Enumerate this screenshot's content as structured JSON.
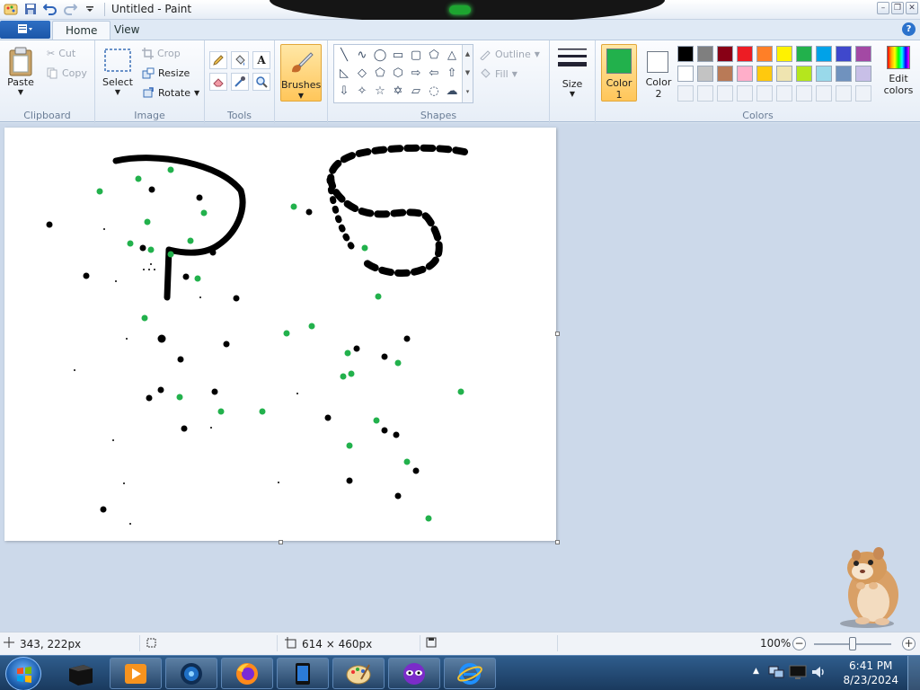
{
  "window": {
    "title": "Untitled - Paint"
  },
  "quick_access": {
    "icons": [
      "paint-app-icon",
      "save-icon",
      "undo-icon",
      "redo-icon",
      "customize-qat-icon"
    ]
  },
  "tabs": [
    {
      "label": "Home"
    },
    {
      "label": "View"
    }
  ],
  "ribbon": {
    "clipboard": {
      "label": "Clipboard",
      "paste": "Paste",
      "cut": "Cut",
      "copy": "Copy"
    },
    "image": {
      "label": "Image",
      "select": "Select",
      "crop": "Crop",
      "resize": "Resize",
      "rotate": "Rotate"
    },
    "tools": {
      "label": "Tools"
    },
    "brushes": {
      "label": "Brushes"
    },
    "shapes": {
      "label": "Shapes",
      "outline": "Outline",
      "fill": "Fill"
    },
    "size": {
      "label": "Size"
    },
    "colors": {
      "label": "Colors",
      "color1_label_line1": "Color",
      "color1_label_line2": "1",
      "color2_label_line1": "Color",
      "color2_label_line2": "2",
      "edit_line1": "Edit",
      "edit_line2": "colors",
      "color1": "#22b14c",
      "color2": "#ffffff",
      "palette_row1": [
        "#000000",
        "#7f7f7f",
        "#880015",
        "#ed1c24",
        "#ff7f27",
        "#fff200",
        "#22b14c",
        "#00a2e8",
        "#3f48cc",
        "#a349a4"
      ],
      "palette_row2": [
        "#ffffff",
        "#c3c3c3",
        "#b97a57",
        "#ffaec9",
        "#ffc90e",
        "#efe4b0",
        "#b5e61d",
        "#99d9ea",
        "#7092be",
        "#c8bfe7"
      ]
    }
  },
  "status": {
    "cursor_pos": "343, 222px",
    "canvas_size": "614 × 460px",
    "zoom": "100%",
    "zoom_level": 0.5
  },
  "taskbar": {
    "time": "6:41 PM",
    "date": "8/23/2024"
  }
}
